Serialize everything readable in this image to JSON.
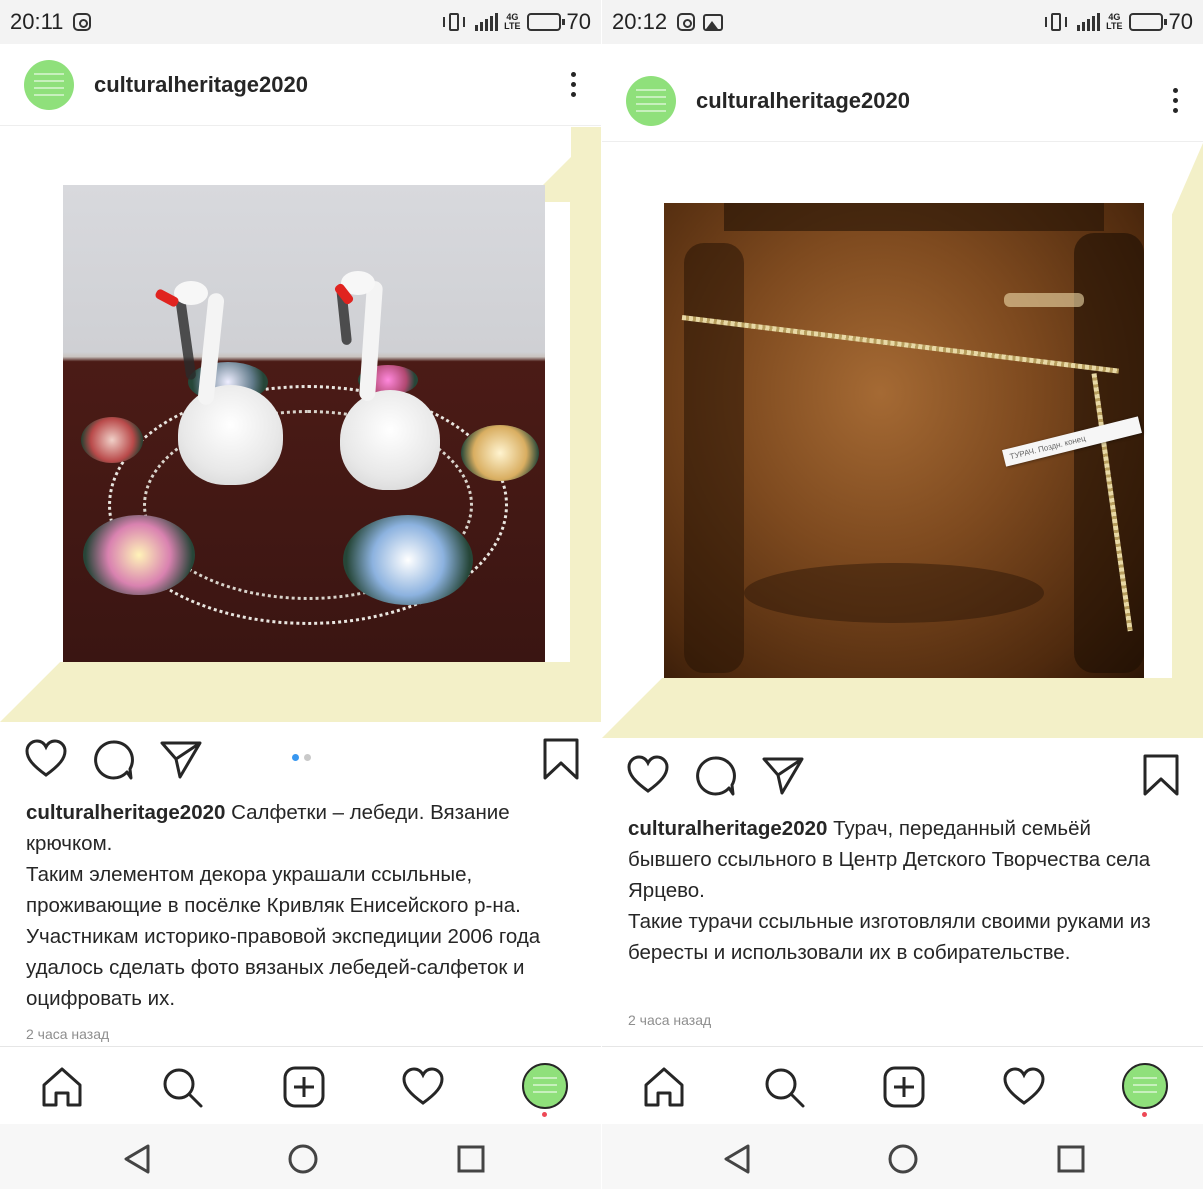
{
  "left": {
    "status": {
      "time": "20:11",
      "battery": "70",
      "network": "4G LTE",
      "battery_level": 0.7
    },
    "header": {
      "username": "culturalheritage2020"
    },
    "carousel": {
      "index": 1,
      "count": 2
    },
    "caption": {
      "username": "culturalheritage2020",
      "first": "Салфетки – лебеди. Вязание крючком.",
      "body": "Таким элементом декора украшали ссыльные, проживающие в посёлке Кривляк Енисейского р-на. Участникам историко-правовой экспедиции 2006 года удалось сделать фото вязаных лебедей-салфеток и оцифровать их."
    },
    "time_ago": "2 часа назад"
  },
  "right": {
    "status": {
      "time": "20:12",
      "battery": "70",
      "network": "4G LTE",
      "battery_level": 0.7
    },
    "header": {
      "username": "culturalheritage2020"
    },
    "photo_label": "ТУРАЧ. Поздн. конец",
    "caption": {
      "username": "culturalheritage2020",
      "first": "Турач, переданный семьёй бывшего ссыльного в Центр Детского Творчества села Ярцево.",
      "body": "Такие турачи ссыльные изготовляли своими руками из бересты и использовали их в собирательстве."
    },
    "time_ago": "2 часа назад"
  },
  "icons": {
    "like": "heart-icon",
    "comment": "comment-icon",
    "share": "send-icon",
    "save": "bookmark-icon",
    "home": "home-icon",
    "search": "search-icon",
    "add": "add-post-icon",
    "activity": "heart-icon",
    "back": "back-triangle-icon",
    "home_circle": "home-circle-icon",
    "recents": "recents-square-icon"
  },
  "colors": {
    "accent_frame": "#f3f0c8",
    "avatar_green": "#8fe07b",
    "dot_active": "#3897f0",
    "notification": "#ed4956"
  }
}
